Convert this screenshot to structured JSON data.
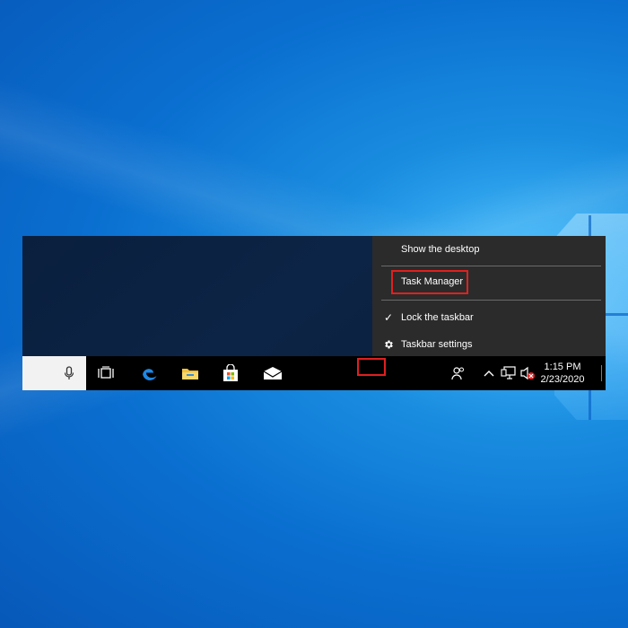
{
  "context_menu": {
    "items": [
      {
        "label": "Show the desktop",
        "glyph": ""
      },
      {
        "label": "Task Manager",
        "glyph": ""
      },
      {
        "label": "Lock the taskbar",
        "glyph": "✓"
      },
      {
        "label": "Taskbar settings",
        "glyph": "gear-icon"
      }
    ]
  },
  "taskbar": {
    "pinned_icons": [
      "microphone-icon",
      "task-view-icon",
      "edge-icon",
      "file-explorer-icon",
      "store-icon",
      "mail-icon"
    ],
    "tray_icons": [
      "people-icon",
      "chevron-up-icon",
      "network-icon",
      "volume-muted-icon"
    ],
    "clock": {
      "time": "1:15 PM",
      "date": "2/23/2020"
    }
  },
  "colors": {
    "menu_bg": "#2b2b2b",
    "taskbar_bg": "#000000",
    "highlight": "#e02020",
    "edge_blue": "#1e88e5"
  }
}
